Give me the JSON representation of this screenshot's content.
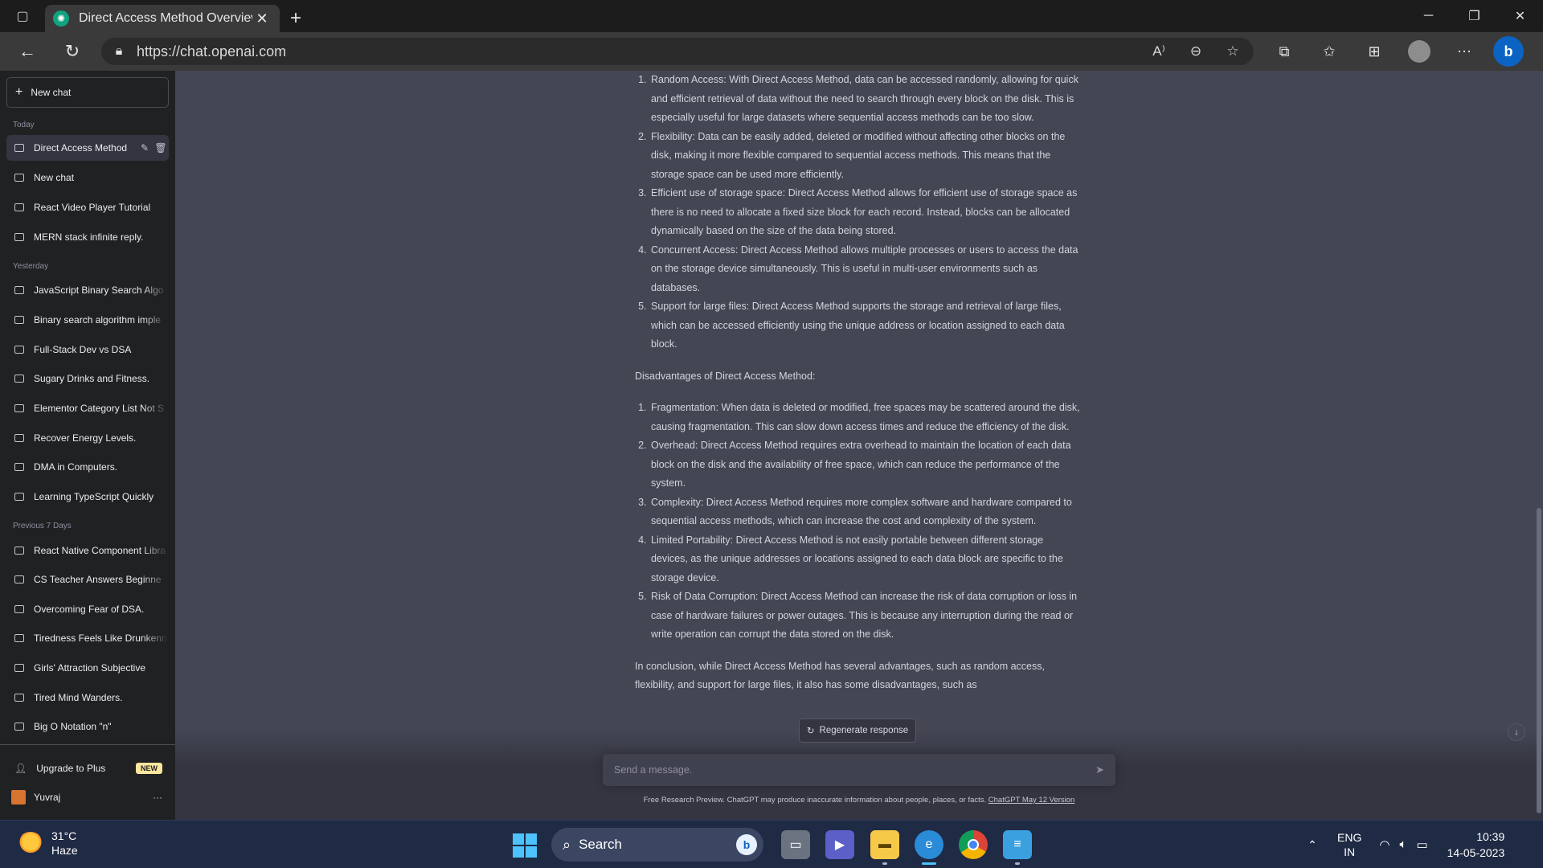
{
  "browser": {
    "tab_title": "Direct Access Method Overview.",
    "url": "https://chat.openai.com",
    "icons": [
      "tab-actions-icon",
      "chatgpt-favicon-icon",
      "close-tab-icon",
      "new-tab-icon",
      "minimize-icon",
      "restore-icon",
      "close-window-icon",
      "back-icon",
      "refresh-icon",
      "lock-icon",
      "read-aloud-icon",
      "zoom-out-icon",
      "add-favorite-icon",
      "extensions-icon",
      "favorites-icon",
      "collections-icon",
      "profile-icon",
      "more-icon",
      "bing-icon"
    ],
    "read_aloud_label": "A⁾"
  },
  "sidebar": {
    "new_chat": "New chat",
    "sections": {
      "today": "Today",
      "yesterday": "Yesterday",
      "previous7": "Previous 7 Days"
    },
    "today_items": [
      "Direct Access Method",
      "New chat",
      "React Video Player Tutorial",
      "MERN stack infinite reply."
    ],
    "yesterday_items": [
      "JavaScript Binary Search Algo",
      "Binary search algorithm imple",
      "Full-Stack Dev vs DSA",
      "Sugary Drinks and Fitness.",
      "Elementor Category List Not S",
      "Recover Energy Levels.",
      "DMA in Computers.",
      "Learning TypeScript Quickly"
    ],
    "previous7_items": [
      "React Native Component Libra",
      "CS Teacher Answers Beginne",
      "Overcoming Fear of DSA.",
      "Tiredness Feels Like Drunkenn",
      "Girls' Attraction Subjective",
      "Tired Mind Wanders.",
      "Big O Notation \"n\""
    ],
    "upgrade_label": "Upgrade to Plus",
    "upgrade_badge": "NEW",
    "user_name": "Yuvraj"
  },
  "content": {
    "advantages": [
      "Random Access: With Direct Access Method, data can be accessed randomly, allowing for quick and efficient retrieval of data without the need to search through every block on the disk. This is especially useful for large datasets where sequential access methods can be too slow.",
      "Flexibility: Data can be easily added, deleted or modified without affecting other blocks on the disk, making it more flexible compared to sequential access methods. This means that the storage space can be used more efficiently.",
      "Efficient use of storage space: Direct Access Method allows for efficient use of storage space as there is no need to allocate a fixed size block for each record. Instead, blocks can be allocated dynamically based on the size of the data being stored.",
      "Concurrent Access: Direct Access Method allows multiple processes or users to access the data on the storage device simultaneously. This is useful in multi-user environments such as databases.",
      "Support for large files: Direct Access Method supports the storage and retrieval of large files, which can be accessed efficiently using the unique address or location assigned to each data block."
    ],
    "disadvantages_heading": "Disadvantages of Direct Access Method:",
    "disadvantages": [
      "Fragmentation: When data is deleted or modified, free spaces may be scattered around the disk, causing fragmentation. This can slow down access times and reduce the efficiency of the disk.",
      "Overhead: Direct Access Method requires extra overhead to maintain the location of each data block on the disk and the availability of free space, which can reduce the performance of the system.",
      "Complexity: Direct Access Method requires more complex software and hardware compared to sequential access methods, which can increase the cost and complexity of the system.",
      "Limited Portability: Direct Access Method is not easily portable between different storage devices, as the unique addresses or locations assigned to each data block are specific to the storage device.",
      "Risk of Data Corruption: Direct Access Method can increase the risk of data corruption or loss in case of hardware failures or power outages. This is because any interruption during the read or write operation can corrupt the data stored on the disk."
    ],
    "conclusion": "In conclusion, while Direct Access Method has several advantages, such as random access, flexibility, and support for large files, it also has some disadvantages, such as"
  },
  "composer": {
    "regenerate": "Regenerate response",
    "placeholder": "Send a message.",
    "footer_text": "Free Research Preview. ChatGPT may produce inaccurate information about people, places, or facts. ",
    "footer_link": "ChatGPT May 12 Version"
  },
  "taskbar": {
    "temperature": "31°C",
    "condition": "Haze",
    "search_label": "Search",
    "language_top": "ENG",
    "language_bottom": "IN",
    "time": "10:39",
    "date": "14-05-2023",
    "apps": [
      "file-manager-icon",
      "teams-icon",
      "file-explorer-icon",
      "edge-icon",
      "chrome-icon",
      "notepad-icon"
    ]
  },
  "colors": {
    "sidebar_bg": "#202123",
    "main_bg": "#444654",
    "accent": "#10a37f",
    "taskbar_bg": "#1f2a44"
  }
}
